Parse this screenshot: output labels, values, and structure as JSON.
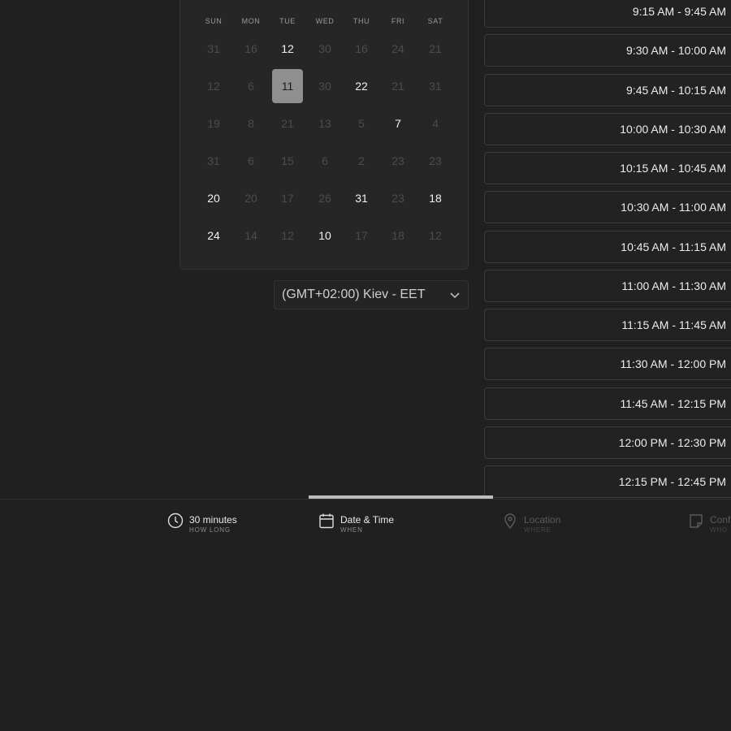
{
  "calendar": {
    "weekdays": [
      "SUN",
      "MON",
      "TUE",
      "WED",
      "THU",
      "FRI",
      "SAT"
    ],
    "weeks": [
      [
        {
          "d": "31",
          "s": "muted"
        },
        {
          "d": "16",
          "s": "muted"
        },
        {
          "d": "12",
          "s": "available"
        },
        {
          "d": "30",
          "s": "muted"
        },
        {
          "d": "16",
          "s": "muted"
        },
        {
          "d": "24",
          "s": "muted"
        },
        {
          "d": "21",
          "s": "muted"
        }
      ],
      [
        {
          "d": "12",
          "s": "muted"
        },
        {
          "d": "6",
          "s": "muted"
        },
        {
          "d": "11",
          "s": "selected"
        },
        {
          "d": "30",
          "s": "muted"
        },
        {
          "d": "22",
          "s": "available"
        },
        {
          "d": "21",
          "s": "muted"
        },
        {
          "d": "31",
          "s": "muted"
        }
      ],
      [
        {
          "d": "19",
          "s": "muted"
        },
        {
          "d": "8",
          "s": "muted"
        },
        {
          "d": "21",
          "s": "muted"
        },
        {
          "d": "13",
          "s": "muted"
        },
        {
          "d": "5",
          "s": "muted"
        },
        {
          "d": "7",
          "s": "available"
        },
        {
          "d": "4",
          "s": "muted"
        }
      ],
      [
        {
          "d": "31",
          "s": "muted"
        },
        {
          "d": "6",
          "s": "muted"
        },
        {
          "d": "15",
          "s": "muted"
        },
        {
          "d": "6",
          "s": "muted"
        },
        {
          "d": "2",
          "s": "muted"
        },
        {
          "d": "23",
          "s": "muted"
        },
        {
          "d": "23",
          "s": "muted"
        }
      ],
      [
        {
          "d": "20",
          "s": "available"
        },
        {
          "d": "20",
          "s": "muted"
        },
        {
          "d": "17",
          "s": "muted"
        },
        {
          "d": "26",
          "s": "muted"
        },
        {
          "d": "31",
          "s": "available"
        },
        {
          "d": "23",
          "s": "muted"
        },
        {
          "d": "18",
          "s": "available"
        }
      ],
      [
        {
          "d": "24",
          "s": "available"
        },
        {
          "d": "14",
          "s": "muted"
        },
        {
          "d": "12",
          "s": "muted"
        },
        {
          "d": "10",
          "s": "available"
        },
        {
          "d": "17",
          "s": "muted"
        },
        {
          "d": "18",
          "s": "muted"
        },
        {
          "d": "12",
          "s": "muted"
        }
      ]
    ]
  },
  "timezone": {
    "value": "(GMT+02:00) Kiev - EET",
    "icon": "chevron-down-icon"
  },
  "time_slots": [
    "9:15 AM - 9:45 AM",
    "9:30 AM - 10:00 AM",
    "9:45 AM - 10:15 AM",
    "10:00 AM - 10:30 AM",
    "10:15 AM - 10:45 AM",
    "10:30 AM - 11:00 AM",
    "10:45 AM - 11:15 AM",
    "11:00 AM - 11:30 AM",
    "11:15 AM - 11:45 AM",
    "11:30 AM - 12:00 PM",
    "11:45 AM - 12:15 PM",
    "12:00 PM - 12:30 PM",
    "12:15 PM - 12:45 PM"
  ],
  "steps": {
    "duration": {
      "label": "30 minutes",
      "sub": "HOW LONG",
      "icon": "clock-icon"
    },
    "datetime": {
      "label": "Date & Time",
      "sub": "WHEN",
      "icon": "calendar-icon"
    },
    "location": {
      "label": "Location",
      "sub": "WHERE",
      "icon": "location-pin-icon"
    },
    "confirm": {
      "label": "Conf",
      "sub": "WHO",
      "icon": "note-icon"
    }
  },
  "colors": {
    "background": "#202020",
    "panel": "#262626",
    "selected_day": "#8f8f8f",
    "progress": "#bdbdbd"
  }
}
